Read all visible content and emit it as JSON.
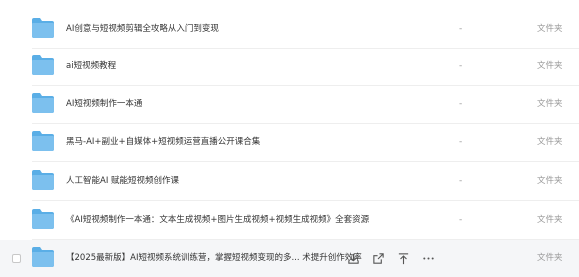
{
  "list": {
    "rows": [
      {
        "name": "AI创意与短视频剪辑全攻略从入门到变现",
        "size": "-",
        "type": "文件夹"
      },
      {
        "name": "ai短视频教程",
        "size": "-",
        "type": "文件夹"
      },
      {
        "name": "AI短视频制作一本通",
        "size": "-",
        "type": "文件夹"
      },
      {
        "name": "黑马-AI+副业+自媒体+短视频运营直播公开课合集",
        "size": "-",
        "type": "文件夹"
      },
      {
        "name": "人工智能AI 赋能短视频创作课",
        "size": "-",
        "type": "文件夹"
      },
      {
        "name": "《AI短视频制作一本通：文本生成视频+图片生成视频+视频生成视频》全套资源",
        "size": "-",
        "type": "文件夹"
      },
      {
        "name": "【2025最新版】AI短视频系统训练营，掌握短视频变现的多... 术提升创作效率",
        "size": "-",
        "type": "文件夹"
      }
    ],
    "row_actions": [
      "download-icon",
      "share-icon",
      "pin-top-icon",
      "more-icon"
    ]
  },
  "colors": {
    "folder_body": "#7cc0ee",
    "folder_tab": "#5aaee6",
    "hover_row": "#f5f6f8",
    "muted_text": "#999999"
  }
}
